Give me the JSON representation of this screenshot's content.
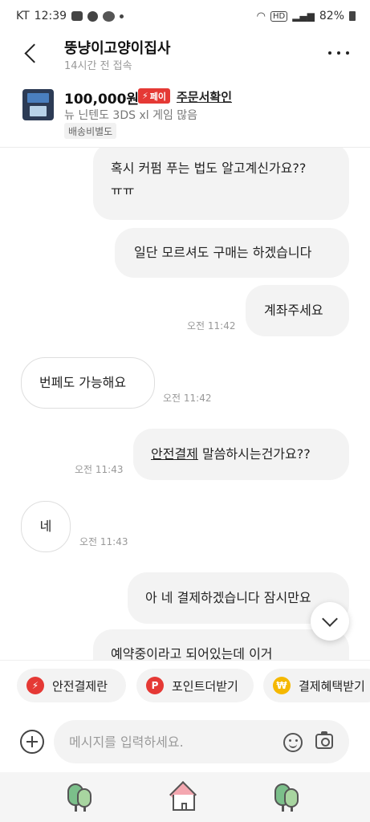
{
  "status_bar": {
    "carrier": "KT",
    "time": "12:39",
    "network": "HD",
    "battery": "82%"
  },
  "header": {
    "shop_name": "뚱냥이고양이집사",
    "last_seen": "14시간 전 접속"
  },
  "product": {
    "price": "100,000원",
    "pay_badge": "페이",
    "order_link": "주문서확인",
    "title": "뉴 닌텐도 3DS xl 게임 많음",
    "shipping": "배송비별도"
  },
  "messages": [
    {
      "side": "out",
      "line1": "혹시 커펌 푸는 법도 알고계신가요??",
      "line2": "ㅠㅠ"
    },
    {
      "side": "out",
      "text": "일단 모르셔도 구매는 하겠습니다"
    },
    {
      "side": "out",
      "text": "계좌주세요",
      "time": "오전 11:42"
    },
    {
      "side": "in",
      "text": "번페도 가능해요",
      "time": "오전 11:42"
    },
    {
      "side": "out",
      "link": "안전결제",
      "rest": " 말씀하시는건가요??",
      "time": "오전 11:43"
    },
    {
      "side": "in",
      "text": "네",
      "time": "오전 11:43"
    },
    {
      "side": "out",
      "text": "아 네 결제하겠습니다 잠시만요"
    },
    {
      "side": "out",
      "text": "예약중이라고 되어있는데 이거"
    }
  ],
  "quick_actions": [
    {
      "label": "안전결제란",
      "icon": "lightning-icon",
      "color": "#e53935"
    },
    {
      "label": "포인트더받기",
      "icon": "p-point-icon",
      "color": "#e53935"
    },
    {
      "label": "결제혜택받기",
      "icon": "won-coin-icon",
      "color": "#f5b800"
    }
  ],
  "input": {
    "placeholder": "메시지를 입력하세요."
  },
  "nav": {
    "icons": [
      "tree-icon",
      "house-icon",
      "tree-icon"
    ]
  },
  "colors": {
    "accent_red": "#e53935",
    "bubble_gray": "#f3f3f3",
    "coin_yellow": "#f5b800"
  }
}
